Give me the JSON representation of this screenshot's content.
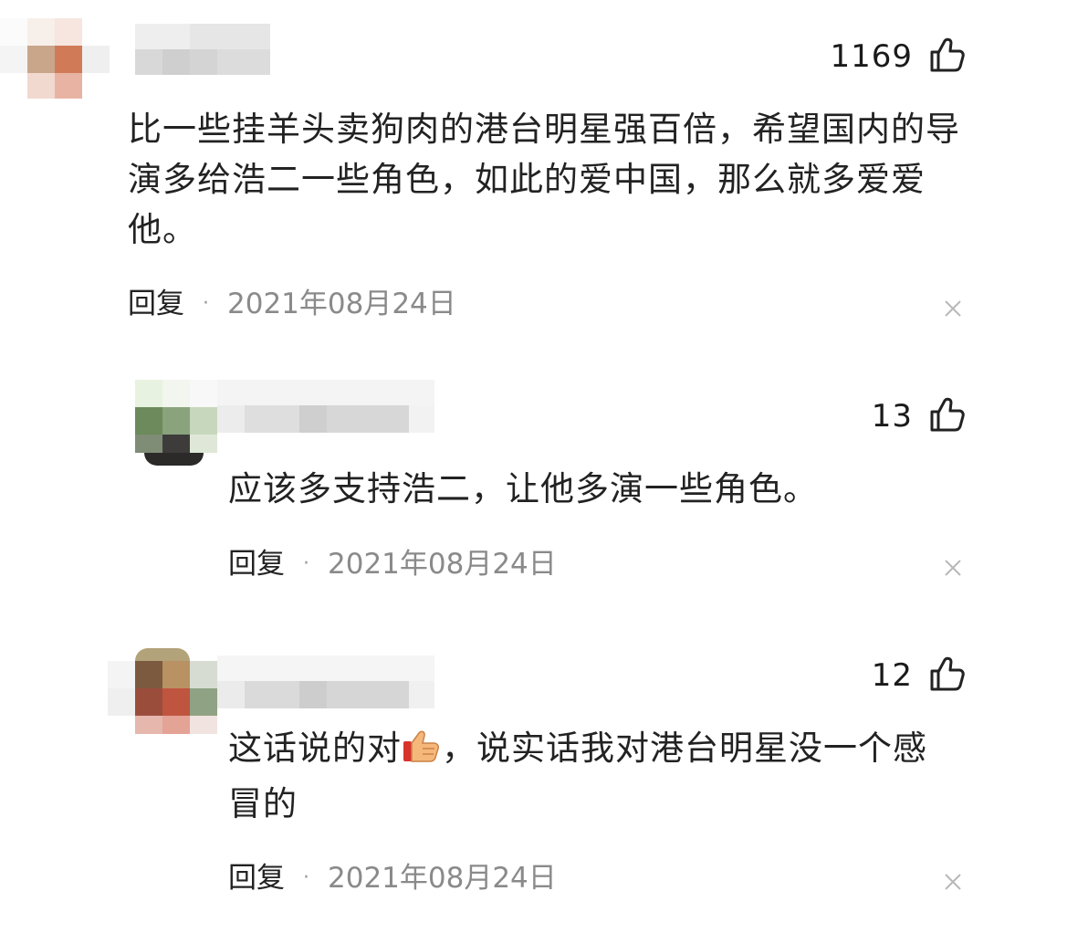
{
  "comments": [
    {
      "likes": "1169",
      "text": "比一些挂羊头卖狗肉的港台明星强百倍，希望国内的导演多给浩二一些角色，如此的爱中国，那么就多爱爱他。",
      "reply_label": "回复",
      "separator": "·",
      "date": "2021年08月24日"
    },
    {
      "likes": "13",
      "text": "应该多支持浩二，让他多演一些角色。",
      "reply_label": "回复",
      "separator": "·",
      "date": "2021年08月24日"
    },
    {
      "likes": "12",
      "text_before_emoji": "这话说的对",
      "emoji": "thumbs-up-emoji",
      "text_after_emoji": "，说实话我对港台明星没一个感冒的",
      "reply_label": "回复",
      "separator": "·",
      "date": "2021年08月24日"
    }
  ],
  "icons": {
    "like": "thumbs-up-outline-icon",
    "close": "close-x-icon"
  },
  "colors": {
    "text": "#222222",
    "date": "#8a8a8a",
    "close": "#b8b8b8",
    "background": "#ffffff"
  }
}
